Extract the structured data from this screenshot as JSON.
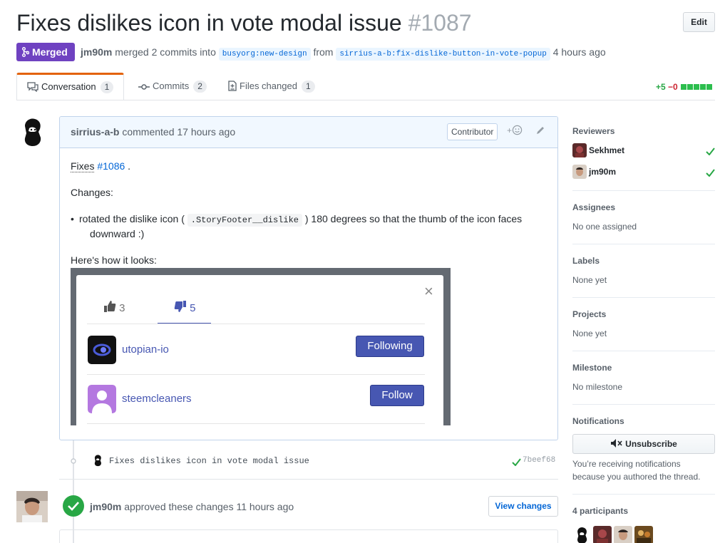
{
  "header": {
    "title": "Fixes dislikes icon in vote modal issue",
    "number": "#1087",
    "edit_label": "Edit"
  },
  "status": {
    "badge": "Merged",
    "author": "jm90m",
    "merged_text": "merged 2 commits into",
    "base_branch": "busyorg:new-design",
    "from_text": "from",
    "head_branch": "sirrius-a-b:fix-dislike-button-in-vote-popup",
    "time": "4 hours ago"
  },
  "tabs": [
    {
      "label": "Conversation",
      "count": "1"
    },
    {
      "label": "Commits",
      "count": "2"
    },
    {
      "label": "Files changed",
      "count": "1"
    }
  ],
  "diffstat": {
    "additions": "+5",
    "deletions": "−0"
  },
  "comment": {
    "author": "sirrius-a-b",
    "action": "commented 17 hours ago",
    "role": "Contributor",
    "fixes_word": "Fixes",
    "fixes_issue": "#1086",
    "fixes_tail": ".",
    "changes_heading": "Changes:",
    "bullet_pre": "rotated the dislike icon (",
    "bullet_code": ".StoryFooter__dislike",
    "bullet_post": ") 180 degrees so that the thumb of the icon faces",
    "bullet_line2": "downward :)",
    "looks_heading": "Here's how it looks:"
  },
  "screenshot": {
    "likes": "3",
    "dislikes": "5",
    "users": [
      {
        "name": "utopian-io",
        "button": "Following"
      },
      {
        "name": "steemcleaners",
        "button": "Follow"
      }
    ]
  },
  "commit": {
    "message": "Fixes dislikes icon in vote modal issue",
    "sha": "7beef68"
  },
  "review": {
    "author": "jm90m",
    "text": "approved these changes 11 hours ago",
    "button": "View changes"
  },
  "sidebar": {
    "reviewers_heading": "Reviewers",
    "reviewers": [
      "Sekhmet",
      "jm90m"
    ],
    "assignees_heading": "Assignees",
    "assignees_value": "No one assigned",
    "labels_heading": "Labels",
    "labels_value": "None yet",
    "projects_heading": "Projects",
    "projects_value": "None yet",
    "milestone_heading": "Milestone",
    "milestone_value": "No milestone",
    "notifications_heading": "Notifications",
    "unsubscribe_label": "Unsubscribe",
    "notify_line1": "You’re receiving notifications",
    "notify_line2": "because you authored the thread.",
    "participants_heading": "4 participants"
  },
  "colors": {
    "merged": "#6f42c1",
    "link": "#0366d6",
    "success": "#28a745",
    "tab_accent": "#e36209",
    "modal_accent": "#4757b2"
  }
}
